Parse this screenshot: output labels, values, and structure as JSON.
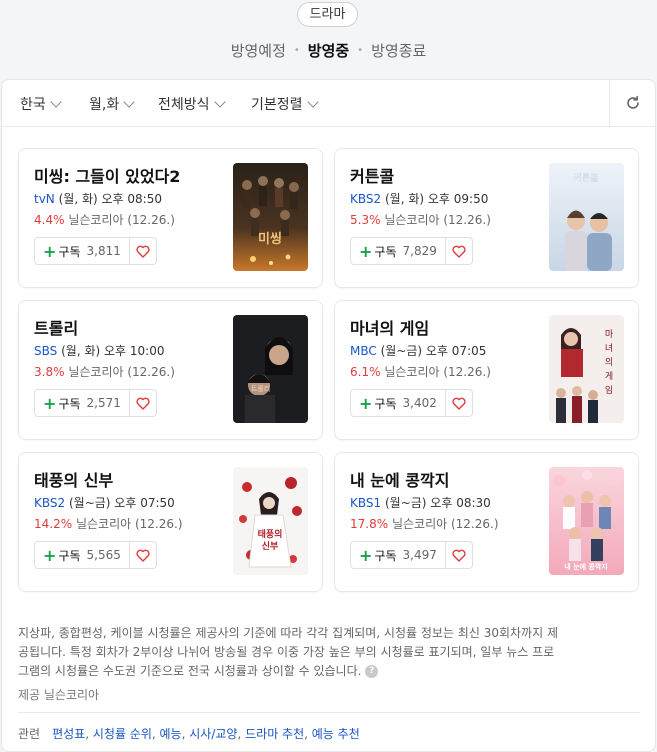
{
  "genre": "드라마",
  "status_tabs": [
    {
      "label": "방영예정",
      "active": false
    },
    {
      "label": "방영중",
      "active": true
    },
    {
      "label": "방영종료",
      "active": false
    }
  ],
  "filters": [
    "한국",
    "월,화",
    "전체방식",
    "기본정렬"
  ],
  "refresh_icon": "refresh-icon",
  "subscribe_label": "구독",
  "accent_colors": {
    "channel": "#1a56c5",
    "rating": "#e03b3b",
    "plus": "#19a14b",
    "heart": "#e03b3b"
  },
  "shows": [
    {
      "title": "미씽: 그들이 있었다2",
      "network": "tvN",
      "schedule": "(월, 화) 오후 08:50",
      "rating": "4.4%",
      "source": "닐슨코리아 (12.26.)",
      "subscribers": "3,811"
    },
    {
      "title": "커튼콜",
      "network": "KBS2",
      "schedule": "(월, 화) 오후 09:50",
      "rating": "5.3%",
      "source": "닐슨코리아 (12.26.)",
      "subscribers": "7,829"
    },
    {
      "title": "트롤리",
      "network": "SBS",
      "schedule": "(월, 화) 오후 10:00",
      "rating": "3.8%",
      "source": "닐슨코리아 (12.26.)",
      "subscribers": "2,571"
    },
    {
      "title": "마녀의 게임",
      "network": "MBC",
      "schedule": "(월~금) 오후 07:05",
      "rating": "6.1%",
      "source": "닐슨코리아 (12.26.)",
      "subscribers": "3,402"
    },
    {
      "title": "태풍의 신부",
      "network": "KBS2",
      "schedule": "(월~금) 오후 07:50",
      "rating": "14.2%",
      "source": "닐슨코리아 (12.26.)",
      "subscribers": "5,565"
    },
    {
      "title": "내 눈에 콩깍지",
      "network": "KBS1",
      "schedule": "(월~금) 오후 08:30",
      "rating": "17.8%",
      "source": "닐슨코리아 (12.26.)",
      "subscribers": "3,497"
    }
  ],
  "note_lines": [
    "지상파, 종합편성, 케이블 시청률은 제공사의 기준에 따라 각각 집계되며, 시청률 정보는 최신 30회차까지 제",
    "공됩니다. 특정 회차가 2부이상 나뉘어 방송될 경우 이중 가장 높은 부의 시청률로 표기되며, 일부 뉴스 프로",
    "그램의 시청률은 수도권 기준으로 전국 시청률과 상이할 수 있습니다."
  ],
  "help_glyph": "?",
  "provider": "제공 닐슨코리아",
  "related_label": "관련",
  "related_links": [
    "편성표",
    "시청률 순위",
    "예능",
    "시사/교양",
    "드라마 추천",
    "예능 추천"
  ]
}
